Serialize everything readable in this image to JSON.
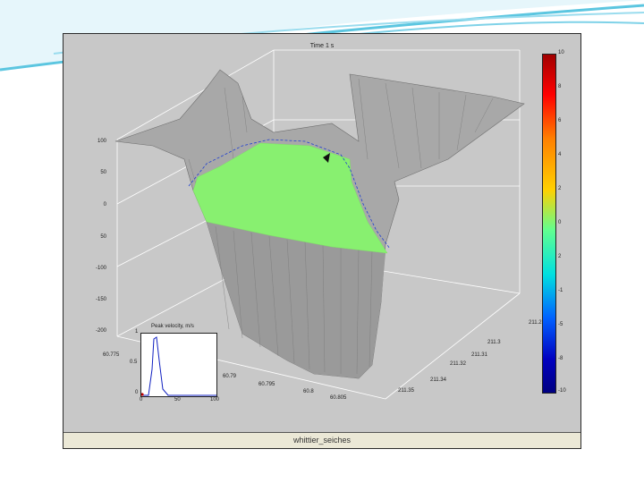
{
  "plot": {
    "title": "Time 1 s",
    "caption": "whittier_seiches",
    "z_ticks": [
      "100",
      "50",
      "0",
      "50",
      "-100",
      "-150",
      "-200"
    ],
    "colorbar_ticks": [
      "10",
      "8",
      "6",
      "4",
      "2",
      "0",
      "2",
      "-1",
      "-5",
      "-8",
      "-10"
    ],
    "colorbar_colors": [
      "#a00000",
      "#ff0000",
      "#ff8000",
      "#ffd000",
      "#c0ff40",
      "#60ff90",
      "#00e0e0",
      "#0090ff",
      "#0040ff",
      "#0000c0",
      "#000080"
    ],
    "lat_ticks": [
      "60.775",
      "60.79",
      "60.795",
      "60.8",
      "60.805"
    ],
    "lon_ticks": [
      "211.28",
      "211.3",
      "211.31",
      "211.32",
      "211.34",
      "211.35"
    ],
    "water_color": "#88f070",
    "mesh_color": "#9a9a9a"
  },
  "inset": {
    "title": "Peak velocity, m/s",
    "y_ticks": [
      "1",
      "0.5",
      "0"
    ],
    "x_ticks": [
      "0",
      "50",
      "100"
    ]
  }
}
